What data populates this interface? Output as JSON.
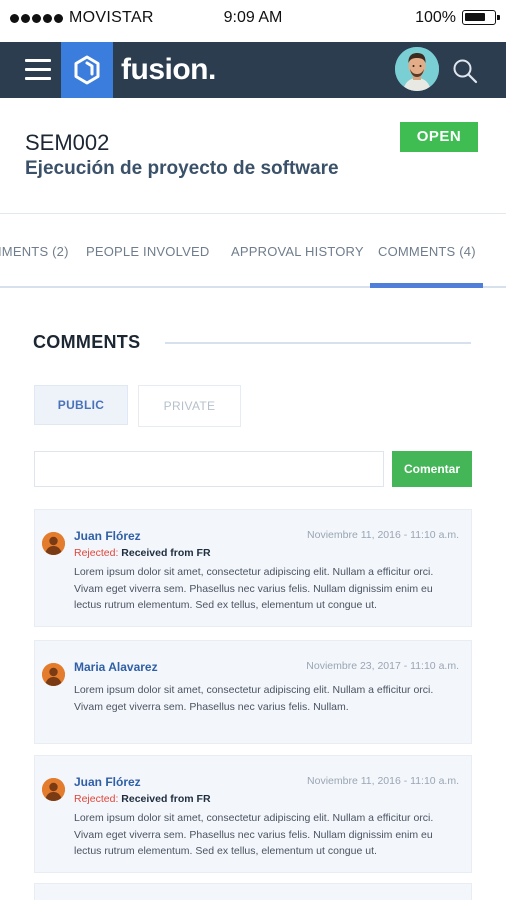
{
  "status_bar": {
    "carrier": "MOVISTAR",
    "time": "9:09 AM",
    "battery": "100%"
  },
  "app_bar": {
    "brand": "fusion."
  },
  "header": {
    "code": "SEM002",
    "title": "Ejecución de proyecto de software",
    "status_badge": "OPEN"
  },
  "tabs": [
    {
      "label": "IMENTS (2)"
    },
    {
      "label": "PEOPLE INVOLVED"
    },
    {
      "label": "APPROVAL HISTORY"
    },
    {
      "label": "COMMENTS (4)",
      "active": true
    }
  ],
  "comments_section": {
    "title": "COMMENTS",
    "public_label": "PUBLIC",
    "private_label": "PRIVATE",
    "input_value": "",
    "submit_label": "Comentar"
  },
  "comments": [
    {
      "author": "Juan Flórez",
      "date": "Noviembre 11, 2016 - 11:10 a.m.",
      "status_label": "Rejected:",
      "status_text": "Received from FR",
      "lines": [
        "Lorem ipsum dolor sit amet, consectetur adipiscing elit. Nullam a efficitur orci.",
        "Vivam eget viverra sem. Phasellus nec varius felis. Nullam dignissim enim eu",
        "lectus rutrum elementum. Sed ex tellus, elementum ut congue ut."
      ]
    },
    {
      "author": "Maria Alavarez",
      "date": "Noviembre 23, 2017 - 11:10 a.m.",
      "lines": [
        "Lorem ipsum dolor sit amet, consectetur adipiscing elit. Nullam a efficitur orci.",
        "Vivam eget viverra sem. Phasellus nec varius felis. Nullam."
      ]
    },
    {
      "author": "Juan Flórez",
      "date": "Noviembre 11, 2016 - 11:10 a.m.",
      "status_label": "Rejected:",
      "status_text": "Received from FR",
      "lines": [
        "Lorem ipsum dolor sit amet, consectetur adipiscing elit. Nullam a efficitur orci.",
        "Vivam eget viverra sem. Phasellus nec varius felis. Nullam dignissim enim eu",
        "lectus rutrum elementum. Sed ex tellus, elementum ut congue ut."
      ]
    }
  ],
  "icons": {
    "menu": "hamburger-icon",
    "logo": "fusion-hexagon-icon",
    "search": "search-icon"
  },
  "colors": {
    "app_bar": "#2c3d4f",
    "brand_blue": "#3b7ddd",
    "open_green": "#3fbc52",
    "active_tab": "#4f7fd8",
    "rejected_red": "#e0463a",
    "author_blue": "#2f5fa6"
  }
}
